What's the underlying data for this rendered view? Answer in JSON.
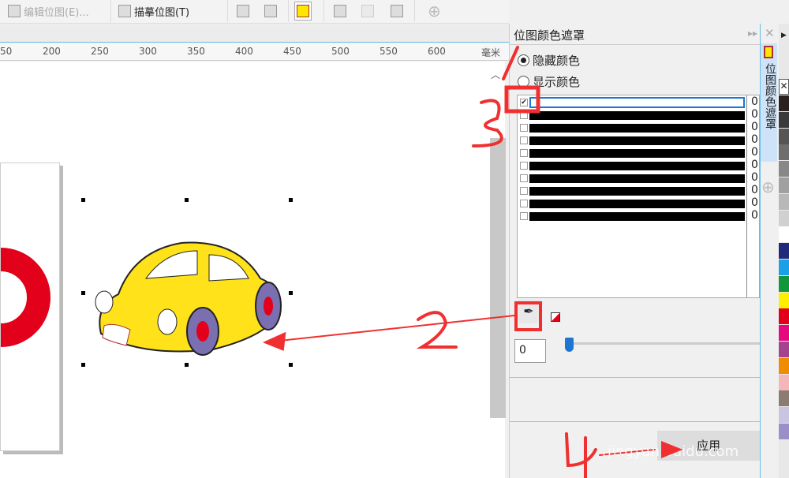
{
  "toolbar": {
    "edit_bitmap": "编辑位图(E)...",
    "trace_bitmap": "描摹位图(T)"
  },
  "ruler": {
    "ticks": [
      "50",
      "200",
      "250",
      "300",
      "350",
      "400",
      "450",
      "500",
      "550",
      "600"
    ],
    "unit": "毫米"
  },
  "panel": {
    "title": "位图颜色遮罩",
    "hide_colors": "隐藏颜色",
    "show_colors": "显示颜色",
    "selected_mode": "hide",
    "rows": [
      {
        "checked": true,
        "value": "0"
      },
      {
        "checked": false,
        "value": "0"
      },
      {
        "checked": false,
        "value": "0"
      },
      {
        "checked": false,
        "value": "0"
      },
      {
        "checked": false,
        "value": "0"
      },
      {
        "checked": false,
        "value": "0"
      },
      {
        "checked": false,
        "value": "0"
      },
      {
        "checked": false,
        "value": "0"
      },
      {
        "checked": false,
        "value": "0"
      },
      {
        "checked": false,
        "value": "0"
      }
    ],
    "tolerance": "0",
    "tolerance_percent": 0,
    "apply": "应用",
    "side_tab": "位图颜色遮罩"
  },
  "annotations": {
    "n2": "2",
    "n3": "3",
    "n4": "4",
    "watermark": "jingyan.baidu.com"
  },
  "palette": [
    "#2b2220",
    "#3a3a3a",
    "#555555",
    "#6e6e6e",
    "#888888",
    "#a0a0a0",
    "#b8b8b8",
    "#d0d0d0",
    "#ffffff",
    "#1f2a7a",
    "#1aa0e6",
    "#12963c",
    "#ffee00",
    "#e3001b",
    "#e5097f",
    "#a6438e",
    "#f08c00",
    "#f4b6b8",
    "#8c7b70",
    "#c8c4e2",
    "#9c8ec8"
  ]
}
